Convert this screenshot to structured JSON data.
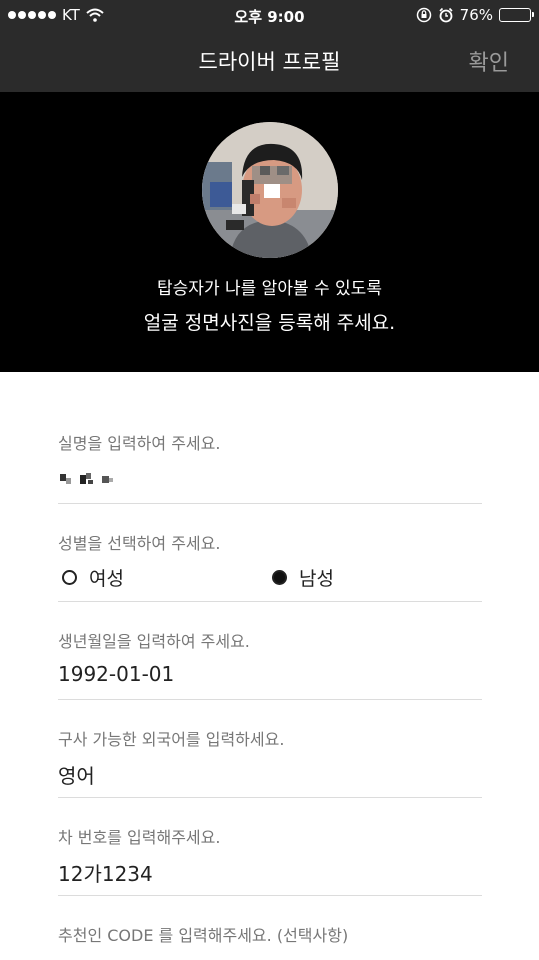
{
  "status_bar": {
    "carrier": "KT",
    "time": "오후 9:00",
    "battery": "76%",
    "battery_level": 0.76
  },
  "nav": {
    "title": "드라이버 프로필",
    "confirm_label": "확인"
  },
  "hero": {
    "line1": "탑승자가 나를 알아볼 수 있도록",
    "line2": "얼굴 정면사진을 등록해 주세요."
  },
  "form": {
    "name": {
      "label": "실명을 입력하여 주세요."
    },
    "gender": {
      "label": "성별을 선택하여 주세요.",
      "options": [
        "여성",
        "남성"
      ],
      "selected": "남성"
    },
    "birthdate": {
      "label": "생년월일을 입력하여 주세요.",
      "value": "1992-01-01"
    },
    "language": {
      "label": "구사 가능한 외국어를 입력하세요.",
      "value": "영어"
    },
    "car_number": {
      "label": "차 번호를 입력해주세요.",
      "value": "12가1234"
    },
    "referral": {
      "label": "추천인 CODE 를 입력해주세요. (선택사항)"
    }
  }
}
